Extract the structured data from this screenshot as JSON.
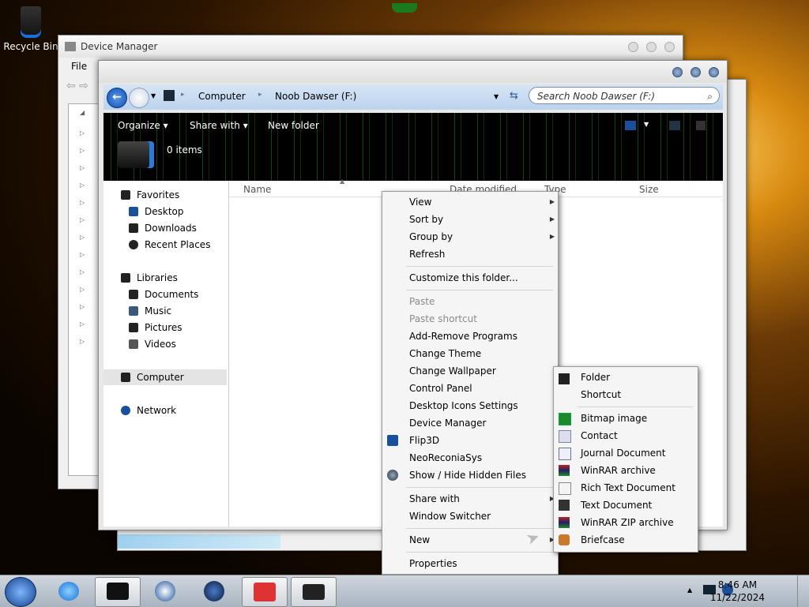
{
  "desktop": {
    "recycle_bin_label": "Recycle Bin"
  },
  "device_manager": {
    "title": "Device Manager",
    "menu_file": "File"
  },
  "explorer": {
    "address": {
      "crumb_computer": "Computer",
      "crumb_drive": "Noob Dawser (F:)"
    },
    "search_placeholder": "Search Noob Dawser (F:)",
    "toolbar": {
      "organize": "Organize",
      "share_with": "Share with",
      "new_folder": "New folder"
    },
    "item_count": "0 items",
    "columns": [
      "Name",
      "Date modified",
      "Type",
      "Size"
    ],
    "nav": {
      "favorites": "Favorites",
      "desktop": "Desktop",
      "downloads": "Downloads",
      "recent_places": "Recent Places",
      "libraries": "Libraries",
      "documents": "Documents",
      "music": "Music",
      "pictures": "Pictures",
      "videos": "Videos",
      "computer": "Computer",
      "network": "Network"
    }
  },
  "context_menu": {
    "view": "View",
    "sort_by": "Sort by",
    "group_by": "Group by",
    "refresh": "Refresh",
    "customize": "Customize this folder...",
    "paste": "Paste",
    "paste_shortcut": "Paste shortcut",
    "add_remove": "Add-Remove Programs",
    "change_theme": "Change Theme",
    "change_wallpaper": "Change Wallpaper",
    "control_panel": "Control Panel",
    "desktop_icons": "Desktop Icons Settings",
    "device_manager": "Device Manager",
    "flip3d": "Flip3D",
    "neoreconia": "NeoReconiaSys",
    "show_hide": "Show / Hide Hidden Files",
    "share_with": "Share with",
    "window_switcher": "Window Switcher",
    "new": "New",
    "properties": "Properties"
  },
  "new_submenu": {
    "folder": "Folder",
    "shortcut": "Shortcut",
    "bitmap": "Bitmap image",
    "contact": "Contact",
    "journal": "Journal Document",
    "winrar": "WinRAR archive",
    "rtf": "Rich Text Document",
    "text": "Text Document",
    "winrar_zip": "WinRAR ZIP archive",
    "briefcase": "Briefcase"
  },
  "taskbar": {
    "time": "8:46 AM",
    "date": "11/22/2024"
  },
  "colors": {
    "taskbar_bg": "#b8c2cc",
    "menu_bg": "#f5f5f5",
    "disabled_text": "#8a8a8a"
  }
}
